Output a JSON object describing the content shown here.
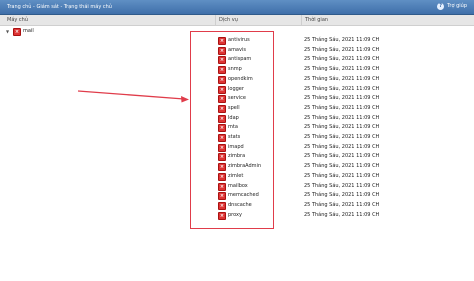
{
  "topbar": {
    "breadcrumb": "Trang chủ - Giám sát - Trạng thái máy chủ",
    "help_label": "Trợ giúp",
    "help_icon": "help-icon"
  },
  "table": {
    "columns": [
      "Máy chủ",
      "Dịch vụ",
      "Thời gian"
    ],
    "host": {
      "name": "mail",
      "status": "error",
      "expanded": true
    },
    "services": [
      {
        "name": "antivirus",
        "time": "25 Tháng Sáu, 2021 11:09 CH"
      },
      {
        "name": "amavis",
        "time": "25 Tháng Sáu, 2021 11:09 CH"
      },
      {
        "name": "antispam",
        "time": "25 Tháng Sáu, 2021 11:09 CH"
      },
      {
        "name": "snmp",
        "time": "25 Tháng Sáu, 2021 11:09 CH"
      },
      {
        "name": "opendkim",
        "time": "25 Tháng Sáu, 2021 11:09 CH"
      },
      {
        "name": "logger",
        "time": "25 Tháng Sáu, 2021 11:09 CH"
      },
      {
        "name": "service",
        "time": "25 Tháng Sáu, 2021 11:09 CH"
      },
      {
        "name": "spell",
        "time": "25 Tháng Sáu, 2021 11:09 CH"
      },
      {
        "name": "ldap",
        "time": "25 Tháng Sáu, 2021 11:09 CH"
      },
      {
        "name": "mta",
        "time": "25 Tháng Sáu, 2021 11:09 CH"
      },
      {
        "name": "stats",
        "time": "25 Tháng Sáu, 2021 11:09 CH"
      },
      {
        "name": "imapd",
        "time": "25 Tháng Sáu, 2021 11:09 CH"
      },
      {
        "name": "zimbra",
        "time": "25 Tháng Sáu, 2021 11:09 CH"
      },
      {
        "name": "zimbraAdmin",
        "time": "25 Tháng Sáu, 2021 11:09 CH"
      },
      {
        "name": "zimlet",
        "time": "25 Tháng Sáu, 2021 11:09 CH"
      },
      {
        "name": "mailbox",
        "time": "25 Tháng Sáu, 2021 11:09 CH"
      },
      {
        "name": "memcached",
        "time": "25 Tháng Sáu, 2021 11:09 CH"
      },
      {
        "name": "dnscache",
        "time": "25 Tháng Sáu, 2021 11:09 CH"
      },
      {
        "name": "proxy",
        "time": "25 Tháng Sáu, 2021 11:09 CH"
      }
    ]
  },
  "annotation": {
    "color": "#e03c4a"
  },
  "colors": {
    "error_icon": "#d33",
    "header_bar": "#4a7bb5"
  }
}
